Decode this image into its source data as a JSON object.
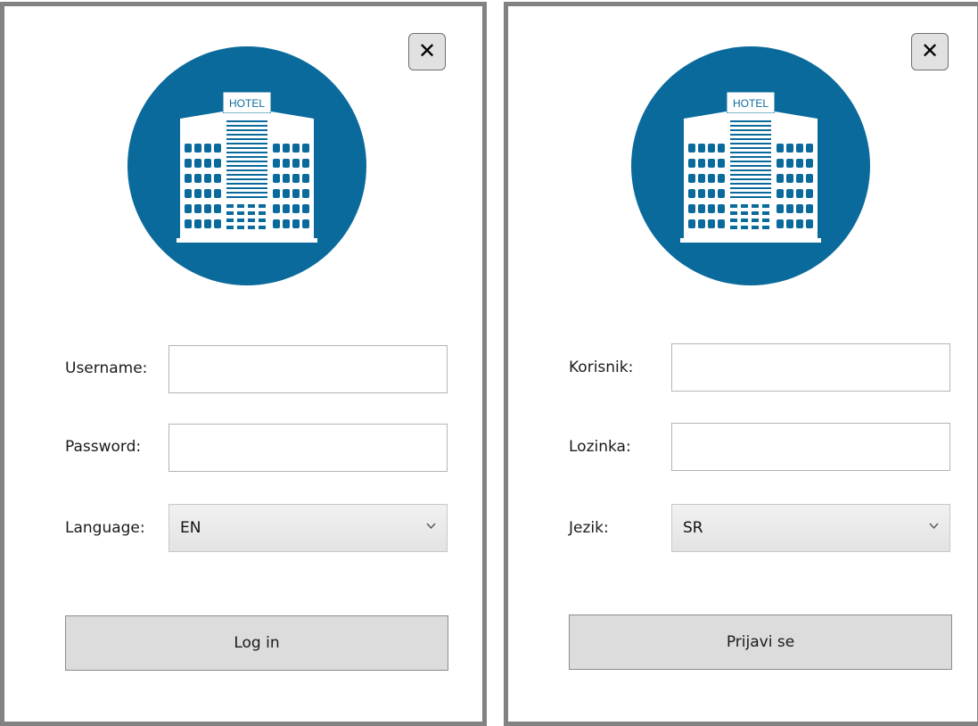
{
  "panels": [
    {
      "close_symbol": "✕",
      "logo": {
        "sign_text": "HOTEL",
        "icon": "hotel-building-icon",
        "circle_color": "#0a6a9c"
      },
      "username_label": "Username:",
      "username_value": "",
      "password_label": "Password:",
      "password_value": "",
      "language_label": "Language:",
      "language_value": "EN",
      "submit_label": "Log in"
    },
    {
      "close_symbol": "✕",
      "logo": {
        "sign_text": "HOTEL",
        "icon": "hotel-building-icon",
        "circle_color": "#0a6a9c"
      },
      "username_label": "Korisnik:",
      "username_value": "",
      "password_label": "Lozinka:",
      "password_value": "",
      "language_label": "Jezik:",
      "language_value": "SR",
      "submit_label": "Prijavi se"
    }
  ]
}
